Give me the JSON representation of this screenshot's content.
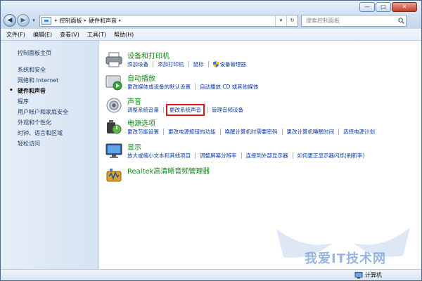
{
  "window": {
    "minimize_glyph": "—",
    "maximize_glyph": "□",
    "close_glyph": "✕"
  },
  "nav": {
    "back_glyph": "◀",
    "forward_glyph": "▶",
    "history_glyph": "▾"
  },
  "address": {
    "breadcrumb": [
      "控制面板",
      "硬件和声音"
    ],
    "separator": "▸",
    "dropdown_glyph": "▾",
    "refresh_glyph": "↻"
  },
  "search": {
    "placeholder": "搜索控制面板"
  },
  "menubar": [
    "文件(F)",
    "编辑(E)",
    "查看(V)",
    "工具(T)",
    "帮助(H)"
  ],
  "sidebar": {
    "home": "控制面板主页",
    "items": [
      {
        "label": "系统和安全",
        "active": false
      },
      {
        "label": "网络和 Internet",
        "active": false
      },
      {
        "label": "硬件和声音",
        "active": true
      },
      {
        "label": "程序",
        "active": false
      },
      {
        "label": "用户帐户和家庭安全",
        "active": false
      },
      {
        "label": "外观和个性化",
        "active": false
      },
      {
        "label": "时钟、语言和区域",
        "active": false
      },
      {
        "label": "轻松访问",
        "active": false
      }
    ]
  },
  "categories": {
    "devices": {
      "title": "设备和打印机",
      "icon": "printer-icon",
      "links": [
        "添加设备",
        "添加打印机",
        "鼠标",
        "设备管理器"
      ]
    },
    "autoplay": {
      "title": "自动播放",
      "icon": "autoplay-icon",
      "links": [
        "更改媒体或设备的默认设置",
        "自动播放 CD 或其他媒体"
      ]
    },
    "sound": {
      "title": "声音",
      "icon": "speaker-icon",
      "links": [
        "调整系统音量",
        "更改系统声音",
        "管理音频设备"
      ],
      "highlighted_link": "更改系统声音"
    },
    "power": {
      "title": "电源选项",
      "icon": "power-icon",
      "links": [
        "更改节能设置",
        "更改电源按钮的功能",
        "唤醒计算机时需要密码",
        "更改计算机睡眠时间",
        "选择电源计划"
      ]
    },
    "display": {
      "title": "显示",
      "icon": "monitor-icon",
      "links": [
        "放大或缩小文本和其他项目",
        "调整屏幕分辨率",
        "连接到外部显示器",
        "如何更正显示器闪烁(刷新率)"
      ]
    },
    "realtek": {
      "title": "Realtek高清晰音频管理器",
      "icon": "realtek-audio-icon",
      "links": []
    }
  },
  "watermark": {
    "text": "我爱IT技术网"
  },
  "status": {
    "label": "计算机"
  },
  "colors": {
    "link": "#0e3ca8",
    "category_title": "#128a19",
    "highlight_box": "#d8151a"
  }
}
